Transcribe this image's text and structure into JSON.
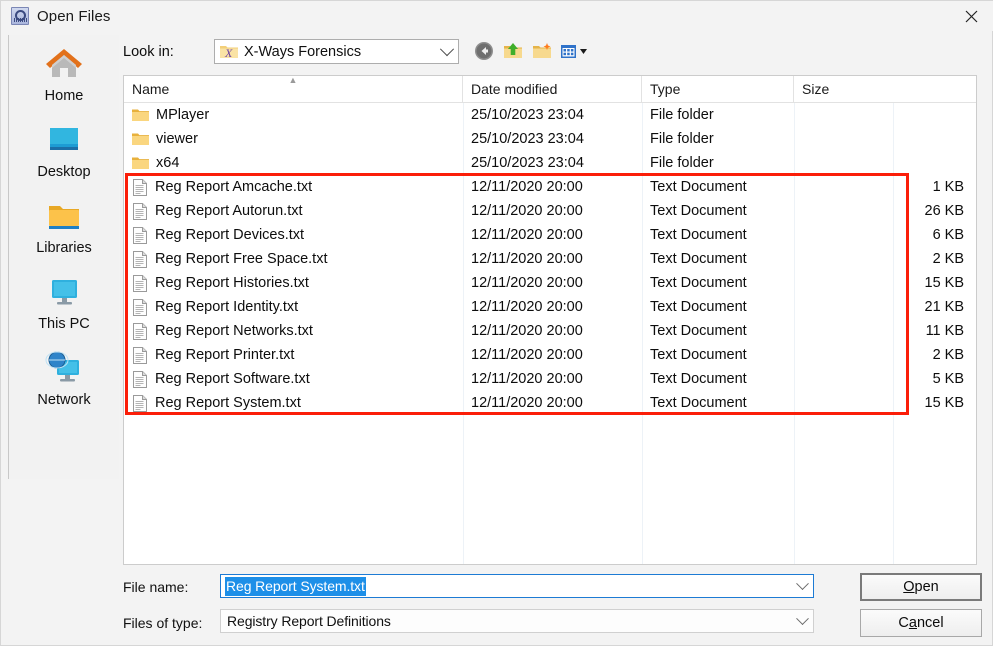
{
  "window": {
    "title": "Open Files",
    "icon": "app-icon",
    "close_label": "✕"
  },
  "places": {
    "items": [
      {
        "label": "Home",
        "icon": "home-icon"
      },
      {
        "label": "Desktop",
        "icon": "desktop-icon"
      },
      {
        "label": "Libraries",
        "icon": "libraries-folder-icon"
      },
      {
        "label": "This PC",
        "icon": "this-pc-monitor-icon"
      },
      {
        "label": "Network",
        "icon": "network-globe-icon"
      }
    ]
  },
  "toolbar": {
    "look_in_label": "Look in:",
    "look_in_value": "X-Ways Forensics",
    "look_in_icon": "xways-folder-icon",
    "buttons": [
      {
        "name": "back-button",
        "icon": "back-arrow-icon"
      },
      {
        "name": "up-one-level-button",
        "icon": "up-folder-icon"
      },
      {
        "name": "new-folder-button",
        "icon": "new-folder-icon"
      },
      {
        "name": "views-button",
        "icon": "views-grid-icon"
      }
    ]
  },
  "filelist": {
    "columns": [
      {
        "label": "Name",
        "sort": "ascending"
      },
      {
        "label": "Date modified",
        "sort": ""
      },
      {
        "label": "Type",
        "sort": ""
      },
      {
        "label": "Size",
        "sort": ""
      }
    ],
    "rows": [
      {
        "name": "MPlayer",
        "date": "25/10/2023 23:04",
        "type": "File folder",
        "size": "",
        "icon": "folder-icon"
      },
      {
        "name": "viewer",
        "date": "25/10/2023 23:04",
        "type": "File folder",
        "size": "",
        "icon": "folder-icon"
      },
      {
        "name": "x64",
        "date": "25/10/2023 23:04",
        "type": "File folder",
        "size": "",
        "icon": "folder-icon"
      },
      {
        "name": "Reg Report Amcache.txt",
        "date": "12/11/2020 20:00",
        "type": "Text Document",
        "size": "1 KB",
        "icon": "text-document-icon"
      },
      {
        "name": "Reg Report Autorun.txt",
        "date": "12/11/2020 20:00",
        "type": "Text Document",
        "size": "26 KB",
        "icon": "text-document-icon"
      },
      {
        "name": "Reg Report Devices.txt",
        "date": "12/11/2020 20:00",
        "type": "Text Document",
        "size": "6 KB",
        "icon": "text-document-icon"
      },
      {
        "name": "Reg Report Free Space.txt",
        "date": "12/11/2020 20:00",
        "type": "Text Document",
        "size": "2 KB",
        "icon": "text-document-icon"
      },
      {
        "name": "Reg Report Histories.txt",
        "date": "12/11/2020 20:00",
        "type": "Text Document",
        "size": "15 KB",
        "icon": "text-document-icon"
      },
      {
        "name": "Reg Report Identity.txt",
        "date": "12/11/2020 20:00",
        "type": "Text Document",
        "size": "21 KB",
        "icon": "text-document-icon"
      },
      {
        "name": "Reg Report Networks.txt",
        "date": "12/11/2020 20:00",
        "type": "Text Document",
        "size": "11 KB",
        "icon": "text-document-icon"
      },
      {
        "name": "Reg Report Printer.txt",
        "date": "12/11/2020 20:00",
        "type": "Text Document",
        "size": "2 KB",
        "icon": "text-document-icon"
      },
      {
        "name": "Reg Report Software.txt",
        "date": "12/11/2020 20:00",
        "type": "Text Document",
        "size": "5 KB",
        "icon": "text-document-icon"
      },
      {
        "name": "Reg Report System.txt",
        "date": "12/11/2020 20:00",
        "type": "Text Document",
        "size": "15 KB",
        "icon": "text-document-icon"
      }
    ]
  },
  "annotation": {
    "color": "#fb1e09",
    "shape": "rectangle-highlight"
  },
  "form": {
    "filename_label": "File name:",
    "filename_value": "Reg Report System.txt",
    "filename_selected": true,
    "filetype_label": "Files of type:",
    "filetype_value": "Registry Report Definitions",
    "open_before": "",
    "open_accel": "O",
    "open_after": "pen",
    "cancel_before": "C",
    "cancel_accel": "a",
    "cancel_after": "ncel"
  },
  "colors": {
    "selection_blue": "#1d8fe8",
    "annotation_red": "#fb1e09",
    "dialog_bg": "#f3f3f3"
  }
}
